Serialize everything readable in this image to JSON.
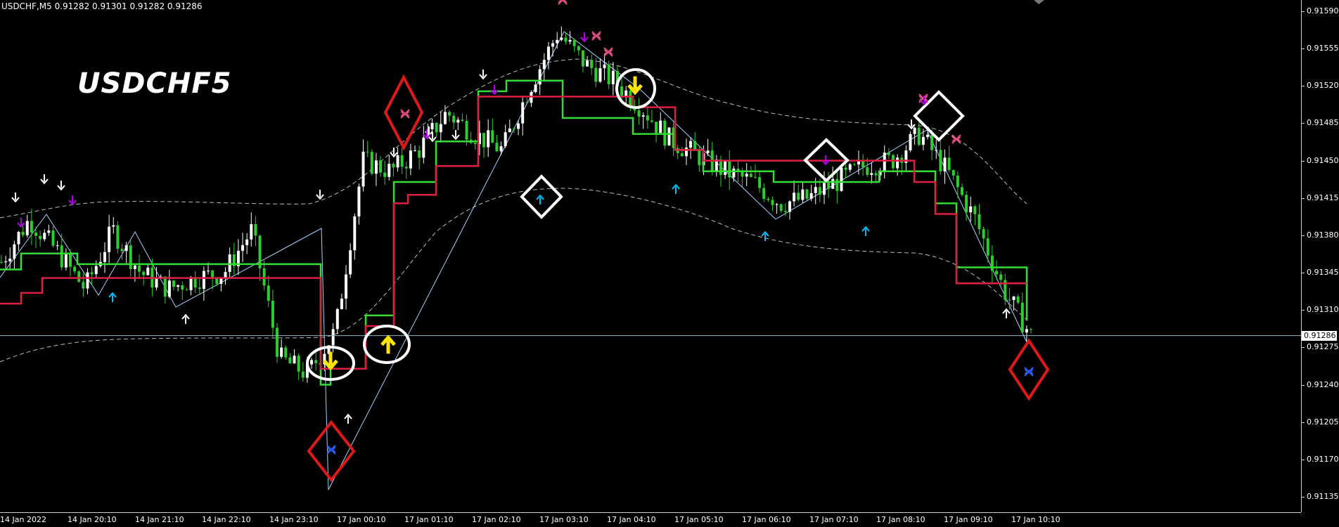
{
  "header": {
    "symbol_info": "USDCHF,M5",
    "ohlc": "0.91282 0.91301 0.91282 0.91286"
  },
  "chart_title": "USDCHF5",
  "current_price": "0.91286",
  "price_axis": {
    "labels": [
      "0.91590",
      "0.91555",
      "0.91520",
      "0.91485",
      "0.91450",
      "0.91415",
      "0.91380",
      "0.91345",
      "0.91310",
      "0.91275",
      "0.91240",
      "0.91205",
      "0.91170",
      "0.91135"
    ]
  },
  "time_axis": {
    "labels": [
      "14 Jan 2022",
      "14 Jan 20:10",
      "14 Jan 21:10",
      "14 Jan 22:10",
      "14 Jan 23:10",
      "17 Jan 00:10",
      "17 Jan 01:10",
      "17 Jan 02:10",
      "17 Jan 03:10",
      "17 Jan 04:10",
      "17 Jan 05:10",
      "17 Jan 06:10",
      "17 Jan 07:10",
      "17 Jan 08:10",
      "17 Jan 09:10",
      "17 Jan 10:10"
    ]
  },
  "colors": {
    "background": "#000000",
    "bull_candle": "#ffffff",
    "bear_candle": "#2ecc2e",
    "green_line": "#33dd33",
    "red_line": "#dd1f43",
    "zigzag": "#9fd2ff",
    "envelope": "#bbbbbb",
    "buy_arrow": "#00c0ff",
    "sell_arrow": "#b000e8",
    "white_arrow": "#ffffff",
    "signal_yellow": "#ffe600",
    "diamond_red": "#e01818"
  },
  "chart_data": {
    "type": "candlestick",
    "instrument": "USDCHF",
    "timeframe": "M5",
    "ylim": [
      0.91118,
      0.916
    ],
    "x": [
      "14 Jan 2022",
      "14 Jan 20:10",
      "14 Jan 21:10",
      "14 Jan 22:10",
      "14 Jan 23:10",
      "17 Jan 00:10",
      "17 Jan 01:10",
      "17 Jan 02:10",
      "17 Jan 03:10",
      "17 Jan 04:10",
      "17 Jan 05:10",
      "17 Jan 06:10",
      "17 Jan 07:10",
      "17 Jan 08:10",
      "17 Jan 09:10",
      "17 Jan 10:10"
    ],
    "close_path": [
      0.91355,
      0.91395,
      0.91365,
      0.9133,
      0.91385,
      0.91345,
      0.9133,
      0.9134,
      0.91345,
      0.91385,
      0.91265,
      0.9125,
      0.9129,
      0.9145,
      0.9144,
      0.9146,
      0.91495,
      0.91475,
      0.9146,
      0.9152,
      0.9157,
      0.9154,
      0.91525,
      0.915,
      0.9147,
      0.91455,
      0.9144,
      0.9143,
      0.9141,
      0.91415,
      0.9143,
      0.91445,
      0.9145,
      0.91475,
      0.9144,
      0.91395,
      0.9133,
      0.91286
    ],
    "series": [
      {
        "name": "green_line",
        "values": [
          0.91348,
          0.91363,
          0.91363,
          0.91353,
          0.91353,
          0.91353,
          0.9124,
          0.91255,
          0.91305,
          0.9143,
          0.9143,
          0.91468,
          0.91468,
          0.91515,
          0.91525,
          0.9149,
          0.91475,
          0.9146,
          0.9144,
          0.9144,
          0.9143,
          0.9143,
          0.9144,
          0.9144,
          0.9141,
          0.9135,
          0.913
        ]
      },
      {
        "name": "red_line",
        "values": [
          0.91316,
          0.91326,
          0.9134,
          0.9134,
          0.9134,
          0.9134,
          0.91255,
          0.91255,
          0.91295,
          0.9141,
          0.91418,
          0.91445,
          0.91445,
          0.9151,
          0.9151,
          0.9151,
          0.915,
          0.9146,
          0.9145,
          0.9145,
          0.9145,
          0.9145,
          0.9145,
          0.9143,
          0.914,
          0.91335,
          0.91335
        ]
      }
    ]
  }
}
